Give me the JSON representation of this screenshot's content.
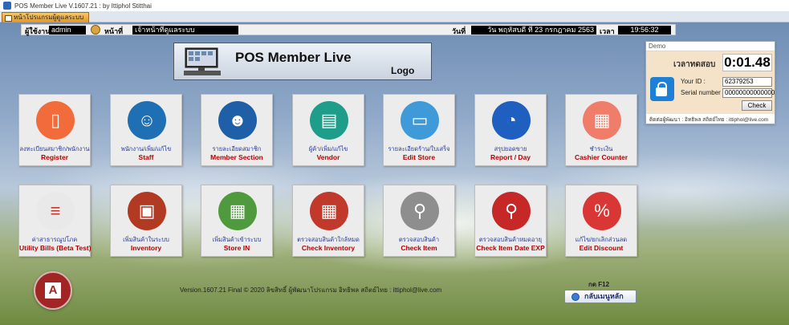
{
  "window": {
    "title": "POS Member Live V.1607.21 : by Ittiphol Stitthai"
  },
  "tab": {
    "label": "หน้าโปรแกรมผู้ดูแลระบบ"
  },
  "info": {
    "user_label": "ผู้ใช้งาน",
    "user_value": "admin",
    "role_label": "หน้าที่",
    "role_value": "เจ้าหน้าที่ดูแลระบบ",
    "date_label": "วันที่",
    "date_value": "วัน พฤหัสบดี ที่ 23 กรกฎาคม 2563",
    "time_label": "เวลา",
    "time_value": "19:56:32"
  },
  "logo": {
    "title": "POS Member Live",
    "subtitle": "Logo"
  },
  "demo": {
    "header": "Demo",
    "timer_label": "เวลาทดสอบ",
    "timer_value": "0:01.48",
    "id_label": "Your ID :",
    "id_value": "62379253",
    "serial_label": "Serial number",
    "serial_value": "00000000000000",
    "check_label": "Check",
    "footer": "ติดต่อผู้พัฒนา : อิทธิพล สถิตย์ไทย : ittiphol@live.com"
  },
  "tiles_row1": [
    {
      "th": "ลงทะเบียนสมาชิก/พนักงาน",
      "en": "Register",
      "color": "#f26b3a",
      "icon": "register-tablet-icon",
      "glyph": "▯"
    },
    {
      "th": "พนักงาน/เพิ่ม/แก้ไข",
      "en": "Staff",
      "color": "#1f6fb5",
      "icon": "staff-person-icon",
      "glyph": "☺"
    },
    {
      "th": "รายละเอียดสมาชิก",
      "en": "Member Section",
      "color": "#1f5fa8",
      "icon": "members-group-icon",
      "glyph": "☻"
    },
    {
      "th": "ผู้ค้า/เพิ่ม/แก้ไข",
      "en": "Vendor",
      "color": "#1e9e8a",
      "icon": "vendor-shop-icon",
      "glyph": "▤"
    },
    {
      "th": "รายละเอียดร้าน/ใบเสร็จ",
      "en": "Edit Store",
      "color": "#3f9ad9",
      "icon": "store-monitor-icon",
      "glyph": "▭"
    },
    {
      "th": "สรุปยอดขาย",
      "en": "Report / Day",
      "color": "#1f5fbf",
      "icon": "report-chart-icon",
      "glyph": "◔"
    },
    {
      "th": "ชำระเงิน",
      "en": "Cashier Counter",
      "color": "#f07c6a",
      "icon": "cash-register-icon",
      "glyph": "▦"
    }
  ],
  "tiles_row2": [
    {
      "th": "ค่าสาธารณูปโภค",
      "en": "Utility Bills (Beta Test)",
      "color": "#e9e9e9",
      "icon": "utility-bills-icon",
      "glyph": "≡"
    },
    {
      "th": "เพิ่มสินค้าในระบบ",
      "en": "Inventory",
      "color": "#b33a22",
      "icon": "inventory-box-icon",
      "glyph": "▣"
    },
    {
      "th": "เพิ่มสินค้าเข้าระบบ",
      "en": "Store IN",
      "color": "#4f9a3c",
      "icon": "store-in-boxes-icon",
      "glyph": "▦"
    },
    {
      "th": "ตรวจสอบสินค้าใกล้หมด",
      "en": "Check Inventory",
      "color": "#c0392b",
      "icon": "check-inventory-icon",
      "glyph": "▦"
    },
    {
      "th": "ตรวจสอบสินค้า",
      "en": "Check Item",
      "color": "#8e8e8e",
      "icon": "check-item-magnifier-icon",
      "glyph": "⚲"
    },
    {
      "th": "ตรวจสอบสินค้าหมดอายุ",
      "en": "Check Item Date EXP",
      "color": "#c62828",
      "icon": "check-expiry-magnifier-icon",
      "glyph": "⚲"
    },
    {
      "th": "แก้ไข/ยกเลิกส่วนลด",
      "en": "Edit Discount",
      "color": "#d93636",
      "icon": "discount-tag-icon",
      "glyph": "%"
    }
  ],
  "footer": {
    "version_text": "Version.1607.21 Final © 2020 ลิขสิทธิ์ ผู้พัฒนาโปรแกรม อิทธิพล สถิตย์ไทย : ittiphol@live.com"
  },
  "menu": {
    "hint": "กด F12",
    "button_label": "กลับเมนูหลัก"
  },
  "access": {
    "letter": "A"
  }
}
